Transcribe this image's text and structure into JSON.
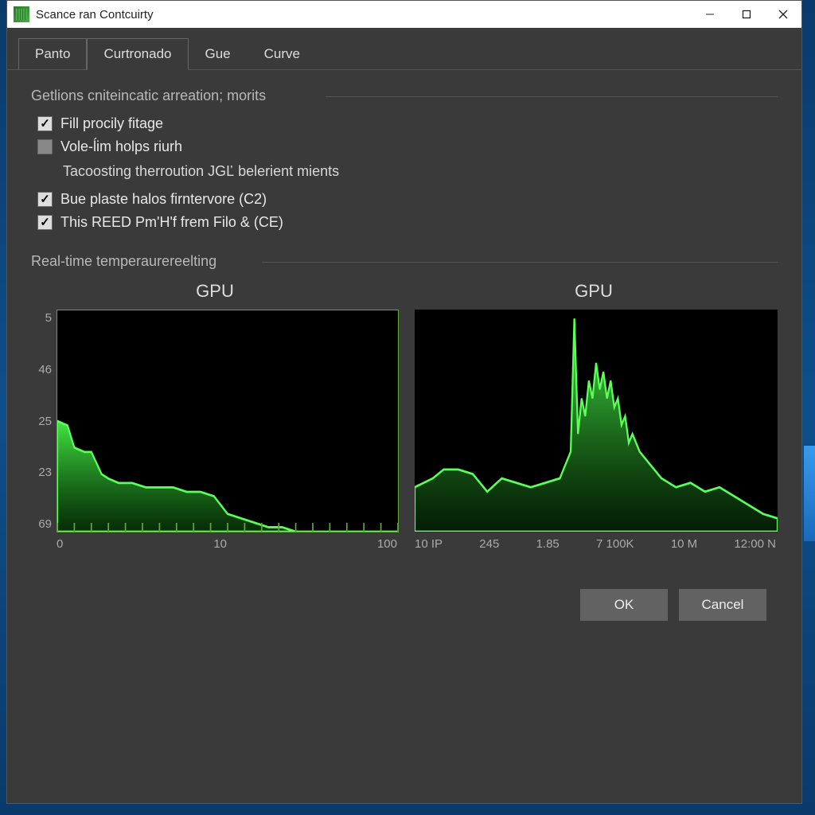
{
  "window": {
    "title": "Scance ran Contcuirty"
  },
  "tabs": [
    {
      "label": "Panto",
      "active": false
    },
    {
      "label": "Curtronado",
      "active": true
    },
    {
      "label": "Gue",
      "active": false
    },
    {
      "label": "Curve",
      "active": false
    }
  ],
  "group1": {
    "title": "Getlions cniteincatic arreation; morits",
    "options": [
      {
        "label": "Fill procily fitage",
        "checked": true
      },
      {
        "label": "Vole-ĺim holps riurh",
        "checked": false
      }
    ],
    "subtext": "Tacoosting therroution JGĽ belerient mients",
    "options2": [
      {
        "label": "Bue plaste halos firntervore (C2)",
        "checked": true
      },
      {
        "label": "This REED Pm'H'f frem Filo & (CE)",
        "checked": true
      }
    ]
  },
  "group2": {
    "title": "Real-time temperaurereelting"
  },
  "chart_data": [
    {
      "type": "area",
      "title": "GPU",
      "y_ticks": [
        "5",
        "46",
        "25",
        "23",
        "69"
      ],
      "x_ticks": [
        "0",
        "10",
        "100"
      ],
      "points": [
        [
          0,
          25
        ],
        [
          3,
          24
        ],
        [
          5,
          19
        ],
        [
          8,
          18
        ],
        [
          10,
          18
        ],
        [
          13,
          13
        ],
        [
          15,
          12
        ],
        [
          18,
          11
        ],
        [
          22,
          11
        ],
        [
          26,
          10
        ],
        [
          30,
          10
        ],
        [
          34,
          10
        ],
        [
          38,
          9
        ],
        [
          42,
          9
        ],
        [
          46,
          8
        ],
        [
          50,
          4
        ],
        [
          54,
          3
        ],
        [
          58,
          2
        ],
        [
          62,
          1
        ],
        [
          66,
          1
        ],
        [
          70,
          0
        ],
        [
          100,
          0
        ]
      ],
      "y_domain": [
        0,
        50
      ]
    },
    {
      "type": "area",
      "title": "GPU",
      "x_ticks": [
        "10 IP",
        "245",
        "1.85",
        "7 100K",
        "10 M",
        "12:00 N"
      ],
      "points": [
        [
          0,
          10
        ],
        [
          5,
          12
        ],
        [
          8,
          14
        ],
        [
          12,
          14
        ],
        [
          16,
          13
        ],
        [
          20,
          9
        ],
        [
          24,
          12
        ],
        [
          28,
          11
        ],
        [
          32,
          10
        ],
        [
          36,
          11
        ],
        [
          40,
          12
        ],
        [
          43,
          18
        ],
        [
          44,
          48
        ],
        [
          45,
          22
        ],
        [
          46,
          30
        ],
        [
          47,
          26
        ],
        [
          48,
          34
        ],
        [
          49,
          30
        ],
        [
          50,
          38
        ],
        [
          51,
          32
        ],
        [
          52,
          36
        ],
        [
          53,
          30
        ],
        [
          54,
          34
        ],
        [
          55,
          28
        ],
        [
          56,
          30
        ],
        [
          57,
          24
        ],
        [
          58,
          26
        ],
        [
          59,
          20
        ],
        [
          60,
          22
        ],
        [
          62,
          18
        ],
        [
          64,
          16
        ],
        [
          66,
          14
        ],
        [
          68,
          12
        ],
        [
          72,
          10
        ],
        [
          76,
          11
        ],
        [
          80,
          9
        ],
        [
          84,
          10
        ],
        [
          88,
          8
        ],
        [
          92,
          6
        ],
        [
          96,
          4
        ],
        [
          100,
          3
        ]
      ],
      "y_domain": [
        0,
        50
      ]
    }
  ],
  "footer": {
    "ok": "OK",
    "cancel": "Cancel"
  }
}
